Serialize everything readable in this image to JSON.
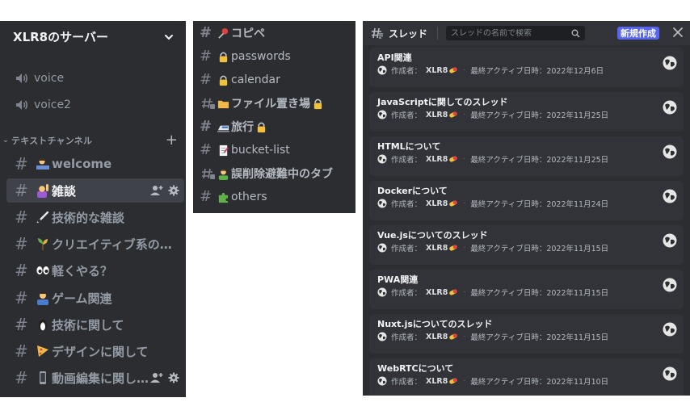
{
  "server": {
    "name": "XLR8のサーバー",
    "voice_channels": [
      {
        "label": "voice",
        "icon": "speaker-icon"
      },
      {
        "label": "voice2",
        "icon": "speaker-icon"
      }
    ],
    "category": {
      "label": "テキストチャンネル",
      "add_icon": "plus-icon"
    },
    "text_channels": [
      {
        "label": "welcome",
        "emoji": "person-at-desk-emoji",
        "active": false
      },
      {
        "label": "雑談",
        "emoji": "raising-hand-emoji",
        "active": true
      },
      {
        "label": "技術的な雑談",
        "emoji": "wand-emoji",
        "active": false
      },
      {
        "label": "クリエイティブ系の…",
        "emoji": "sprout-emoji",
        "active": false
      },
      {
        "label": "軽くやる？",
        "emoji": "eyes-emoji",
        "active": false
      },
      {
        "label": "ゲーム関連",
        "emoji": "gamer-emoji",
        "active": false
      },
      {
        "label": "技術に関して",
        "emoji": "penguin-emoji",
        "active": false
      },
      {
        "label": "デザインに関して",
        "emoji": "pizza-emoji",
        "active": false
      },
      {
        "label": "動画編集に関し…",
        "emoji": "phone-emoji",
        "active": false
      }
    ]
  },
  "channel_list": [
    {
      "label": "コピペ",
      "emoji": "pushpin-emoji",
      "bold": true,
      "thread": false
    },
    {
      "label": "passwords",
      "emoji": "lock-emoji",
      "bold": false,
      "thread": false
    },
    {
      "label": "calendar",
      "emoji": "lock-emoji",
      "bold": false,
      "thread": false
    },
    {
      "label": "ファイル置き場",
      "emoji": "folder-emoji",
      "trailing_emoji": "lock-emoji",
      "bold": true,
      "thread": true
    },
    {
      "label": "旅行",
      "emoji": "train-emoji",
      "trailing_emoji": "lock-emoji",
      "bold": true,
      "thread": false
    },
    {
      "label": "bucket-list",
      "emoji": "memo-emoji",
      "bold": false,
      "thread": false
    },
    {
      "label": "誤削除避難中のタブ",
      "emoji": "person-emoji",
      "bold": true,
      "thread": true
    },
    {
      "label": "others",
      "emoji": "puzzle-emoji",
      "bold": false,
      "thread": false
    }
  ],
  "threads_panel": {
    "title": "スレッド",
    "search_placeholder": "スレッドの名前で検索",
    "new_button": "新規作成",
    "owner_label": "作成者：",
    "activity_label": "最終アクティブ日時：",
    "threads": [
      {
        "name": "API関連",
        "owner": "XLR8",
        "last_active": "2022年12月6日"
      },
      {
        "name": "JavaScriptに関してのスレッド",
        "owner": "XLR8",
        "last_active": "2022年11月25日"
      },
      {
        "name": "HTMLについて",
        "owner": "XLR8",
        "last_active": "2022年11月25日"
      },
      {
        "name": "Dockerについて",
        "owner": "XLR8",
        "last_active": "2022年11月24日"
      },
      {
        "name": "Vue.jsについてのスレッド",
        "owner": "XLR8",
        "last_active": "2022年11月15日"
      },
      {
        "name": "PWA関連",
        "owner": "XLR8",
        "last_active": "2022年11月15日"
      },
      {
        "name": "Nuxt.jsについてのスレッド",
        "owner": "XLR8",
        "last_active": "2022年11月15日"
      },
      {
        "name": "WebRTCについて",
        "owner": "XLR8",
        "last_active": "2022年11月10日"
      }
    ]
  },
  "colors": {
    "background": "#2b2d31",
    "card": "#313338",
    "active_row": "#404249",
    "accent": "#5865f2",
    "text_muted": "#949ba4"
  }
}
